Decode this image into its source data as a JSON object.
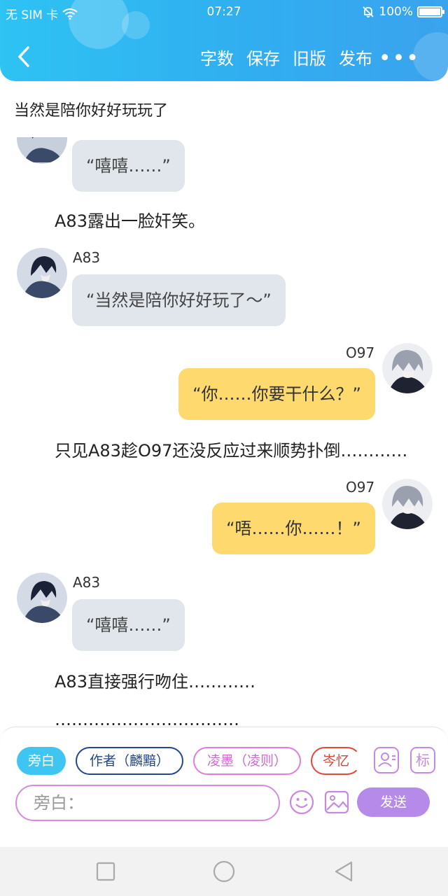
{
  "status": {
    "carrier": "无 SIM 卡",
    "time": "07:27",
    "battery": "100%",
    "battery_level": 1.0
  },
  "toolbar": {
    "items": [
      "字数",
      "保存",
      "旧版",
      "发布"
    ],
    "more": "•••"
  },
  "chat": {
    "top_line": "当然是陪你好好玩玩了",
    "msg1": {
      "text": "“嘻嘻……”"
    },
    "narr1": "A83露出一脸奸笑。",
    "msg2": {
      "name": "A83",
      "text": "“当然是陪你好好玩了～”"
    },
    "msg3": {
      "name": "O97",
      "text": "“你……你要干什么？”"
    },
    "narr2": "只见A83趁O97还没反应过来顺势扑倒…………",
    "msg4": {
      "name": "O97",
      "text": "“唔……你……！”"
    },
    "msg5": {
      "name": "A83",
      "text": "“嘻嘻……”"
    },
    "narr3": "A83直接强行吻住…………",
    "narr4": "……………………………"
  },
  "input_panel": {
    "roles": [
      "旁白",
      "作者（麟黯）",
      "凌墨（凌则）",
      "岑忆"
    ],
    "tag_button": "标",
    "placeholder": "旁白：",
    "send_label": "发送"
  },
  "colors": {
    "header": "#31aef0",
    "narration_chip": "#3fc5f2",
    "send": "#b58ae8",
    "bubble_left": "#e1e6ec",
    "bubble_right": "#fdd96e"
  }
}
